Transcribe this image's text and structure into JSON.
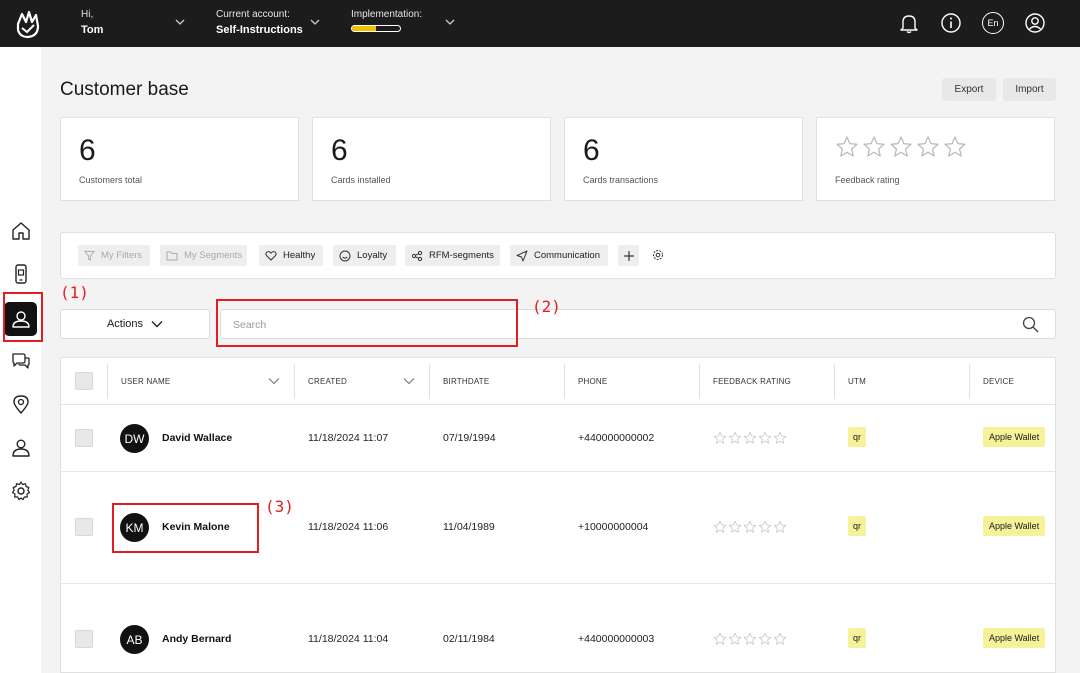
{
  "topbar": {
    "greeting": "Hi,",
    "user_name": "Tom",
    "account_label": "Current account:",
    "account_name": "Self-Instructions",
    "implementation_label": "Implementation:",
    "implementation_progress": 0.5,
    "language": "En"
  },
  "page": {
    "title": "Customer base",
    "export_label": "Export",
    "import_label": "Import"
  },
  "stats": [
    {
      "value": "6",
      "label": "Customers total"
    },
    {
      "value": "6",
      "label": "Cards installed"
    },
    {
      "value": "6",
      "label": "Cards transactions"
    },
    {
      "label": "Feedback rating",
      "rating": 0,
      "max": 5
    }
  ],
  "filters": {
    "my_filters": "My Filters",
    "my_segments": "My Segments",
    "healthy": "Healthy",
    "loyalty": "Loyalty",
    "rfm": "RFM-segments",
    "communication": "Communication"
  },
  "toolbar": {
    "actions_label": "Actions",
    "search_placeholder": "Search"
  },
  "annotations": {
    "a1": "(1)",
    "a2": "(2)",
    "a3": "(3)"
  },
  "table": {
    "columns": {
      "user_name": "USER NAME",
      "created": "CREATED",
      "birthdate": "BIRTHDATE",
      "phone": "PHONE",
      "feedback": "FEEDBACK RATING",
      "utm": "UTM",
      "device": "DEVICE"
    },
    "rows": [
      {
        "initials": "DW",
        "name": "David Wallace",
        "created": "11/18/2024 11:07",
        "birthdate": "07/19/1994",
        "phone": "+440000000002",
        "utm": "qr",
        "device": "Apple Wallet"
      },
      {
        "initials": "KM",
        "name": "Kevin Malone",
        "created": "11/18/2024 11:06",
        "birthdate": "11/04/1989",
        "phone": "+10000000004",
        "utm": "qr",
        "device": "Apple Wallet"
      },
      {
        "initials": "AB",
        "name": "Andy Bernard",
        "created": "11/18/2024 11:04",
        "birthdate": "02/11/1984",
        "phone": "+440000000003",
        "utm": "qr",
        "device": "Apple Wallet"
      }
    ]
  },
  "colors": {
    "topbar_bg": "#1c1c1c",
    "progress_fill": "#f2c200",
    "badge_bg": "#f6f29a",
    "annotation": "#e02020"
  }
}
